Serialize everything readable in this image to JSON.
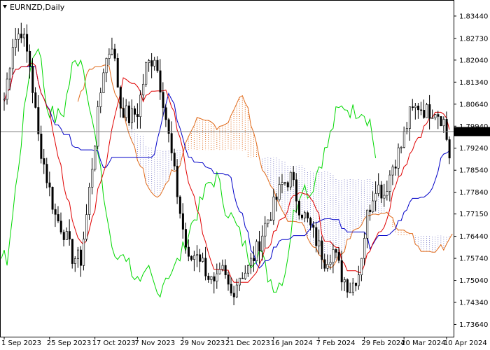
{
  "window": {
    "title": "EURNZD,Daily",
    "menu_icon": "triangle-down-icon"
  },
  "chart_data": {
    "type": "candlestick",
    "symbol": "EURNZD",
    "timeframe": "Daily",
    "ylim": [
      1.7325,
      1.8395
    ],
    "y_ticks": [
      "1.83440",
      "1.82730",
      "1.82040",
      "1.81340",
      "1.80640",
      "1.79940",
      "1.79240",
      "1.78540",
      "1.77840",
      "1.77150",
      "1.76440",
      "1.75740",
      "1.75040",
      "1.74340",
      "1.73640"
    ],
    "x_ticks": [
      {
        "label": "1 Sep 2023",
        "bar": 0
      },
      {
        "label": "25 Sep 2023",
        "bar": 16
      },
      {
        "label": "17 Oct 2023",
        "bar": 32
      },
      {
        "label": "7 Nov 2023",
        "bar": 47
      },
      {
        "label": "29 Nov 2023",
        "bar": 63
      },
      {
        "label": "21 Dec 2023",
        "bar": 79
      },
      {
        "label": "16 Jan 2024",
        "bar": 95
      },
      {
        "label": "7 Feb 2024",
        "bar": 111
      },
      {
        "label": "29 Feb 2024",
        "bar": 127
      },
      {
        "label": "20 Mar 2024",
        "bar": 141
      },
      {
        "label": "10 Apr 2024",
        "bar": 156
      }
    ],
    "current_price": "1.79769",
    "bar_count": 158,
    "key_closes": [
      [
        0,
        1.808
      ],
      [
        3,
        1.826
      ],
      [
        6,
        1.83
      ],
      [
        9,
        1.819
      ],
      [
        12,
        1.796
      ],
      [
        15,
        1.783
      ],
      [
        18,
        1.771
      ],
      [
        21,
        1.766
      ],
      [
        24,
        1.758
      ],
      [
        27,
        1.757
      ],
      [
        29,
        1.771
      ],
      [
        32,
        1.795
      ],
      [
        35,
        1.818
      ],
      [
        38,
        1.826
      ],
      [
        41,
        1.806
      ],
      [
        44,
        1.802
      ],
      [
        47,
        1.804
      ],
      [
        50,
        1.818
      ],
      [
        53,
        1.822
      ],
      [
        56,
        1.808
      ],
      [
        59,
        1.79
      ],
      [
        62,
        1.772
      ],
      [
        65,
        1.756
      ],
      [
        68,
        1.76
      ],
      [
        71,
        1.754
      ],
      [
        74,
        1.748
      ],
      [
        77,
        1.753
      ],
      [
        80,
        1.746
      ],
      [
        83,
        1.752
      ],
      [
        86,
        1.754
      ],
      [
        89,
        1.76
      ],
      [
        92,
        1.768
      ],
      [
        95,
        1.774
      ],
      [
        98,
        1.781
      ],
      [
        101,
        1.783
      ],
      [
        104,
        1.774
      ],
      [
        107,
        1.769
      ],
      [
        110,
        1.763
      ],
      [
        113,
        1.757
      ],
      [
        116,
        1.76
      ],
      [
        119,
        1.752
      ],
      [
        122,
        1.748
      ],
      [
        125,
        1.753
      ],
      [
        128,
        1.771
      ],
      [
        131,
        1.781
      ],
      [
        134,
        1.778
      ],
      [
        137,
        1.787
      ],
      [
        140,
        1.793
      ],
      [
        143,
        1.803
      ],
      [
        146,
        1.806
      ],
      [
        149,
        1.804
      ],
      [
        152,
        1.805
      ],
      [
        155,
        1.801
      ],
      [
        157,
        1.79
      ]
    ],
    "colors": {
      "background": "#ffffff",
      "candle": "#000000",
      "tenkan": "#e00000",
      "kijun": "#0000c8",
      "chikou": "#00d800",
      "cloud_bull": "#e06a1a",
      "cloud_bear": "#8888cc",
      "price_line": "#808080",
      "price_label_bg": "#000000",
      "price_label_fg": "#ffffff"
    },
    "indicator": "Ichimoku Kinko Hyo"
  }
}
